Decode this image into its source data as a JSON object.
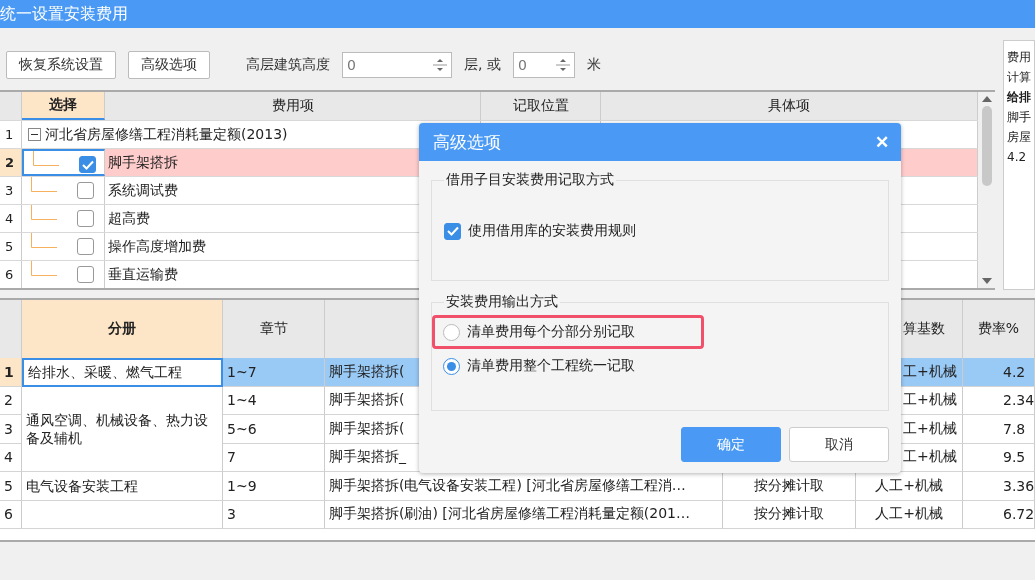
{
  "window": {
    "title": "统一设置安装费用"
  },
  "toolbar": {
    "buttons": [
      "恢复系统设置",
      "高级选项"
    ],
    "height_label": "高层建筑高度",
    "floors_value": "0",
    "floors_unit": "层, 或",
    "meters_value": "0",
    "meters_unit": "米"
  },
  "top_table": {
    "columns": [
      "选择",
      "费用项",
      "记取位置",
      "具体项"
    ],
    "root": {
      "num": "1",
      "label": "河北省房屋修缮工程消耗量定额(2013)",
      "expanded": true
    },
    "rows": [
      {
        "num": "2",
        "name": "脚手架搭拆",
        "checked": true,
        "selected": true
      },
      {
        "num": "3",
        "name": "系统调试费",
        "checked": false,
        "selected": false
      },
      {
        "num": "4",
        "name": "超高费",
        "checked": false,
        "selected": false
      },
      {
        "num": "5",
        "name": "操作高度增加费",
        "checked": false,
        "selected": false
      },
      {
        "num": "6",
        "name": "垂直运输费",
        "checked": false,
        "selected": false
      }
    ]
  },
  "side_panel": {
    "lines": [
      {
        "text": "费用",
        "bold": false
      },
      {
        "text": "计算",
        "bold": false
      },
      {
        "text": "给排",
        "bold": true
      },
      {
        "text": "脚手",
        "bold": false
      },
      {
        "text": "房屋",
        "bold": false
      },
      {
        "text": "4.2",
        "bold": false
      }
    ]
  },
  "bottom_table": {
    "columns": [
      {
        "label": "分册"
      },
      {
        "label": "章节"
      },
      {},
      {},
      {
        "label": "算基数"
      },
      {
        "label": "费率%"
      }
    ],
    "groups": [
      {
        "label": "给排水、采暖、燃气工程",
        "rows": [
          {
            "num": "1",
            "chapter": "1~7",
            "item": "脚手架搭拆(",
            "base": "工+机械",
            "rate": "4.2",
            "selected": true
          }
        ]
      },
      {
        "label": "通风空调、机械设备、热力设备及辅机",
        "rows": [
          {
            "num": "2",
            "chapter": "1~4",
            "item": "脚手架搭拆(",
            "base": "工+机械",
            "rate": "2.34",
            "selected": false
          },
          {
            "num": "3",
            "chapter": "5~6",
            "item": "脚手架搭拆(",
            "base": "工+机械",
            "rate": "7.8",
            "selected": false
          },
          {
            "num": "4",
            "chapter": "7",
            "item": "脚手架搭拆_",
            "base": "工+机械",
            "rate": "9.5",
            "selected": false
          }
        ]
      },
      {
        "label": "电气设备安装工程",
        "rows": [
          {
            "num": "5",
            "chapter": "1~9",
            "item": "脚手架搭拆(电气设备安装工程) [河北省房屋修缮工程消…",
            "record": "按分摊计取",
            "base": "人工+机械",
            "rate": "3.36",
            "selected": false
          }
        ]
      },
      {
        "rows": [
          {
            "num": "6",
            "chapter": "3",
            "item": "脚手架搭拆(刷油) [河北省房屋修缮工程消耗量定额(201…",
            "record": "按分摊计取",
            "base": "人工+机械",
            "rate": "6.72",
            "selected": false
          }
        ]
      }
    ]
  },
  "dialog": {
    "title": "高级选项",
    "close": "✕",
    "group1": {
      "legend": "借用子目安装费用记取方式",
      "checkbox": {
        "label": "使用借用库的安装费用规则",
        "checked": true
      }
    },
    "group2": {
      "legend": "安装费用输出方式",
      "options": [
        {
          "label": "清单费用每个分部分别记取",
          "selected": false,
          "highlighted": true
        },
        {
          "label": "清单费用整个工程统一记取",
          "selected": true,
          "highlighted": false
        }
      ]
    },
    "buttons": [
      {
        "label": "确定",
        "kind": "primary"
      },
      {
        "label": "取消",
        "kind": "secondary"
      }
    ]
  }
}
